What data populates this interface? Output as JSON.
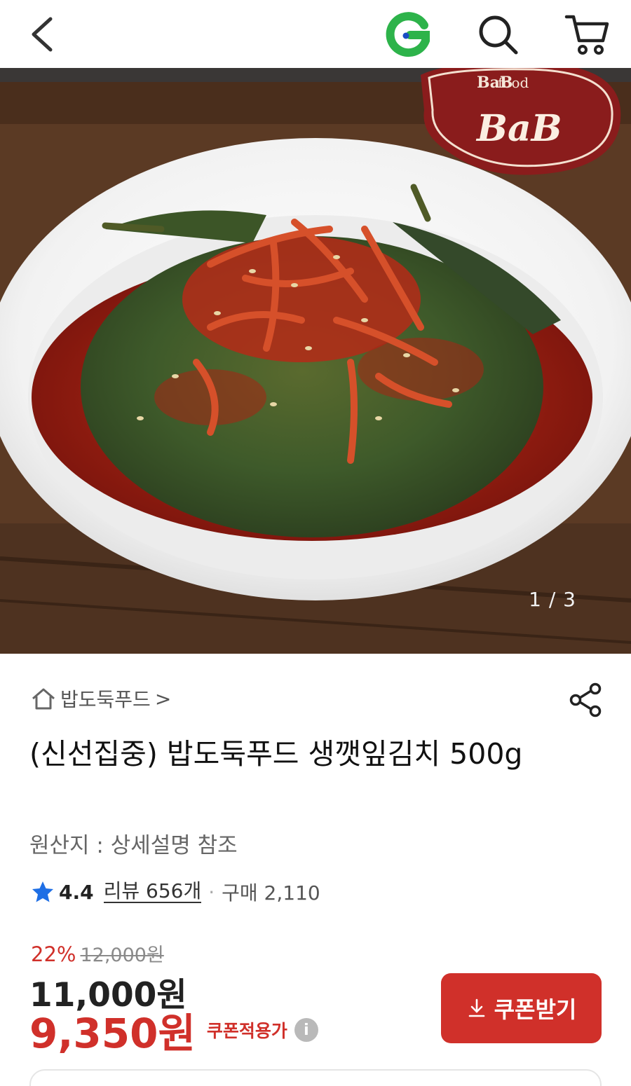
{
  "header": {
    "back_icon": "chevron-left-icon",
    "logo_letter": "G",
    "search_icon": "search-icon",
    "cart_icon": "cart-icon"
  },
  "gallery": {
    "counter": "1 / 3",
    "brand_logo_text_top": "BaB",
    "brand_logo_text_mid": "food",
    "brand_logo_text_main": "BaB"
  },
  "product": {
    "store_name": "밥도둑푸드",
    "store_suffix": ">",
    "title": "(신선집중) 밥도둑푸드 생깻잎김치 500g",
    "origin": "원산지 : 상세설명 참조",
    "rating": "4.4",
    "reviews": "리뷰 656개",
    "separator": "·",
    "purchases": "구매 2,110",
    "discount_rate": "22%",
    "original_price": "12,000원",
    "price": "11,000원",
    "coupon_price": "9,350원",
    "coupon_label": "쿠폰적용가",
    "info_glyph": "i",
    "coupon_button": "쿠폰받기"
  },
  "colors": {
    "accent": "#d0302a",
    "logo_green": "#2db34a",
    "logo_blue": "#1a4cc4"
  }
}
